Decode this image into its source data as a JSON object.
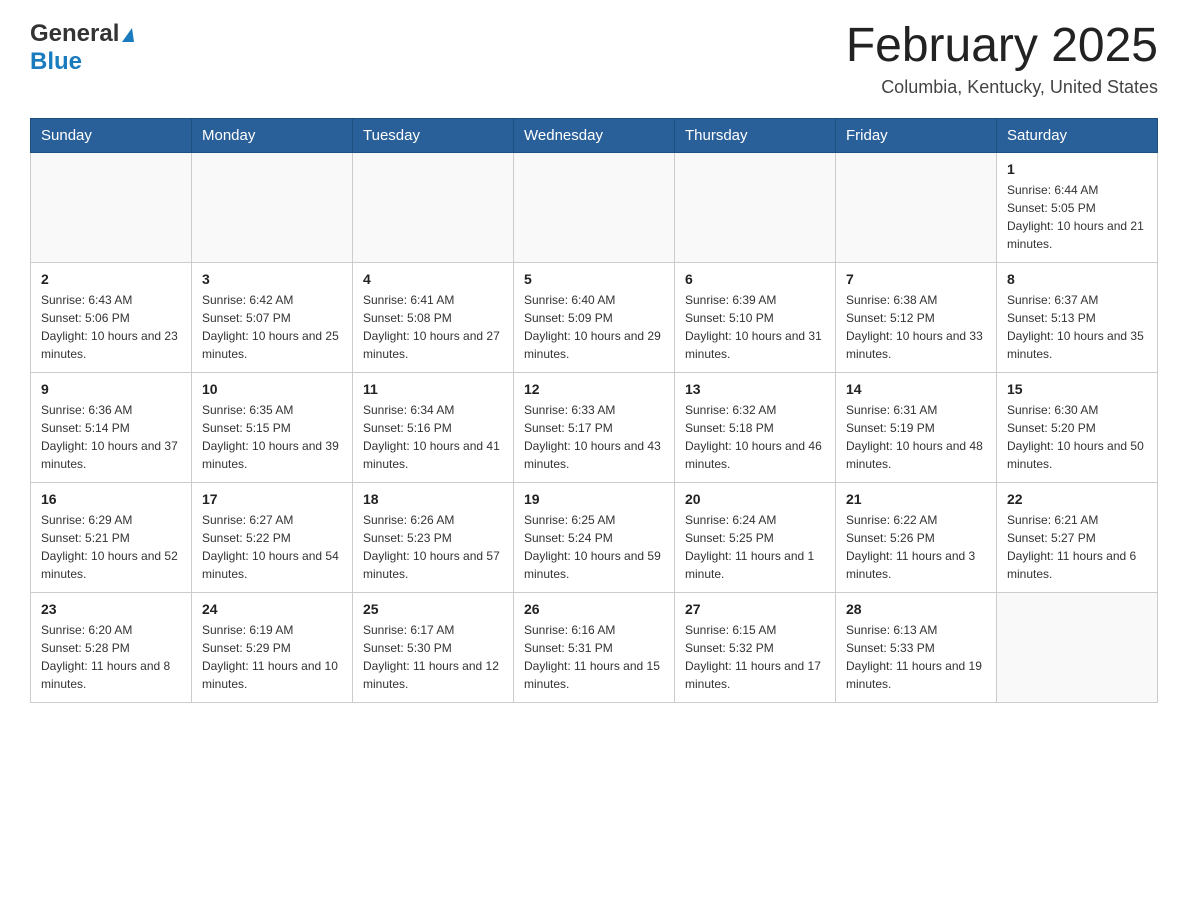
{
  "header": {
    "logo": {
      "general": "General",
      "blue": "Blue"
    },
    "title": "February 2025",
    "subtitle": "Columbia, Kentucky, United States"
  },
  "weekdays": [
    "Sunday",
    "Monday",
    "Tuesday",
    "Wednesday",
    "Thursday",
    "Friday",
    "Saturday"
  ],
  "weeks": [
    [
      {
        "day": "",
        "info": ""
      },
      {
        "day": "",
        "info": ""
      },
      {
        "day": "",
        "info": ""
      },
      {
        "day": "",
        "info": ""
      },
      {
        "day": "",
        "info": ""
      },
      {
        "day": "",
        "info": ""
      },
      {
        "day": "1",
        "info": "Sunrise: 6:44 AM\nSunset: 5:05 PM\nDaylight: 10 hours and 21 minutes."
      }
    ],
    [
      {
        "day": "2",
        "info": "Sunrise: 6:43 AM\nSunset: 5:06 PM\nDaylight: 10 hours and 23 minutes."
      },
      {
        "day": "3",
        "info": "Sunrise: 6:42 AM\nSunset: 5:07 PM\nDaylight: 10 hours and 25 minutes."
      },
      {
        "day": "4",
        "info": "Sunrise: 6:41 AM\nSunset: 5:08 PM\nDaylight: 10 hours and 27 minutes."
      },
      {
        "day": "5",
        "info": "Sunrise: 6:40 AM\nSunset: 5:09 PM\nDaylight: 10 hours and 29 minutes."
      },
      {
        "day": "6",
        "info": "Sunrise: 6:39 AM\nSunset: 5:10 PM\nDaylight: 10 hours and 31 minutes."
      },
      {
        "day": "7",
        "info": "Sunrise: 6:38 AM\nSunset: 5:12 PM\nDaylight: 10 hours and 33 minutes."
      },
      {
        "day": "8",
        "info": "Sunrise: 6:37 AM\nSunset: 5:13 PM\nDaylight: 10 hours and 35 minutes."
      }
    ],
    [
      {
        "day": "9",
        "info": "Sunrise: 6:36 AM\nSunset: 5:14 PM\nDaylight: 10 hours and 37 minutes."
      },
      {
        "day": "10",
        "info": "Sunrise: 6:35 AM\nSunset: 5:15 PM\nDaylight: 10 hours and 39 minutes."
      },
      {
        "day": "11",
        "info": "Sunrise: 6:34 AM\nSunset: 5:16 PM\nDaylight: 10 hours and 41 minutes."
      },
      {
        "day": "12",
        "info": "Sunrise: 6:33 AM\nSunset: 5:17 PM\nDaylight: 10 hours and 43 minutes."
      },
      {
        "day": "13",
        "info": "Sunrise: 6:32 AM\nSunset: 5:18 PM\nDaylight: 10 hours and 46 minutes."
      },
      {
        "day": "14",
        "info": "Sunrise: 6:31 AM\nSunset: 5:19 PM\nDaylight: 10 hours and 48 minutes."
      },
      {
        "day": "15",
        "info": "Sunrise: 6:30 AM\nSunset: 5:20 PM\nDaylight: 10 hours and 50 minutes."
      }
    ],
    [
      {
        "day": "16",
        "info": "Sunrise: 6:29 AM\nSunset: 5:21 PM\nDaylight: 10 hours and 52 minutes."
      },
      {
        "day": "17",
        "info": "Sunrise: 6:27 AM\nSunset: 5:22 PM\nDaylight: 10 hours and 54 minutes."
      },
      {
        "day": "18",
        "info": "Sunrise: 6:26 AM\nSunset: 5:23 PM\nDaylight: 10 hours and 57 minutes."
      },
      {
        "day": "19",
        "info": "Sunrise: 6:25 AM\nSunset: 5:24 PM\nDaylight: 10 hours and 59 minutes."
      },
      {
        "day": "20",
        "info": "Sunrise: 6:24 AM\nSunset: 5:25 PM\nDaylight: 11 hours and 1 minute."
      },
      {
        "day": "21",
        "info": "Sunrise: 6:22 AM\nSunset: 5:26 PM\nDaylight: 11 hours and 3 minutes."
      },
      {
        "day": "22",
        "info": "Sunrise: 6:21 AM\nSunset: 5:27 PM\nDaylight: 11 hours and 6 minutes."
      }
    ],
    [
      {
        "day": "23",
        "info": "Sunrise: 6:20 AM\nSunset: 5:28 PM\nDaylight: 11 hours and 8 minutes."
      },
      {
        "day": "24",
        "info": "Sunrise: 6:19 AM\nSunset: 5:29 PM\nDaylight: 11 hours and 10 minutes."
      },
      {
        "day": "25",
        "info": "Sunrise: 6:17 AM\nSunset: 5:30 PM\nDaylight: 11 hours and 12 minutes."
      },
      {
        "day": "26",
        "info": "Sunrise: 6:16 AM\nSunset: 5:31 PM\nDaylight: 11 hours and 15 minutes."
      },
      {
        "day": "27",
        "info": "Sunrise: 6:15 AM\nSunset: 5:32 PM\nDaylight: 11 hours and 17 minutes."
      },
      {
        "day": "28",
        "info": "Sunrise: 6:13 AM\nSunset: 5:33 PM\nDaylight: 11 hours and 19 minutes."
      },
      {
        "day": "",
        "info": ""
      }
    ]
  ]
}
